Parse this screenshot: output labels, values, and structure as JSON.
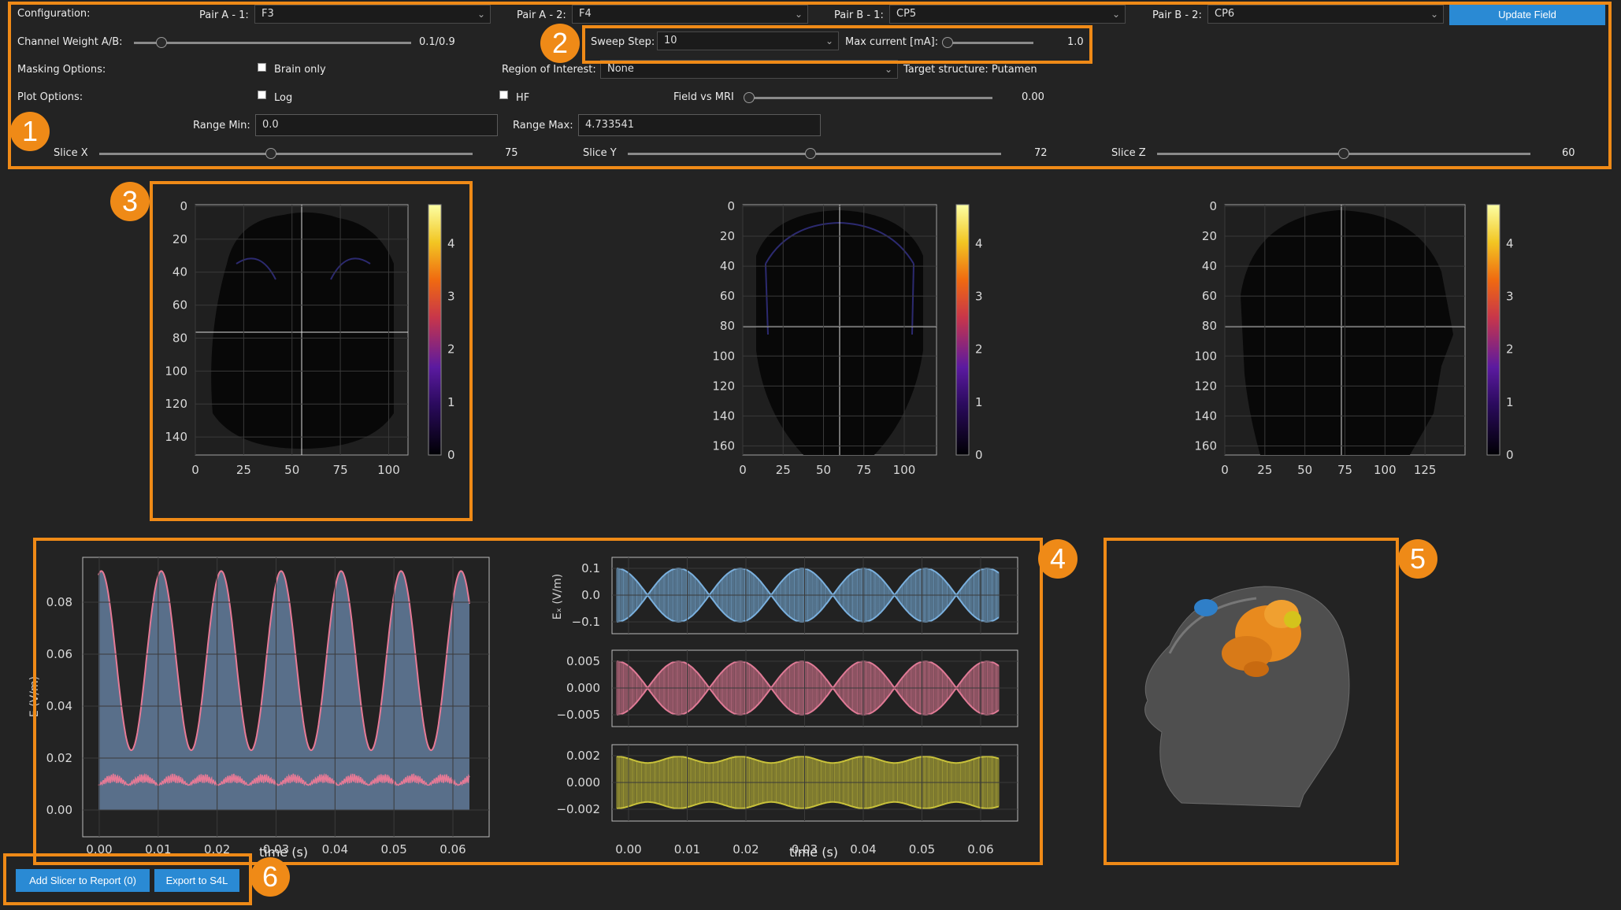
{
  "config": {
    "configuration_label": "Configuration:",
    "pair_a1_label": "Pair A - 1:",
    "pair_a1_value": "F3",
    "pair_a2_label": "Pair A - 2:",
    "pair_a2_value": "F4",
    "pair_b1_label": "Pair B - 1:",
    "pair_b1_value": "CP5",
    "pair_b2_label": "Pair B - 2:",
    "pair_b2_value": "CP6",
    "update_button": "Update Field",
    "channel_weight_label": "Channel Weight A/B:",
    "channel_weight_value": "0.1/0.9",
    "channel_weight_fraction": 0.1,
    "sweep_step_label": "Sweep Step:",
    "sweep_step_value": "10",
    "max_current_label": "Max current [mA]:",
    "max_current_value": "1.0",
    "masking_label": "Masking Options:",
    "brain_only_label": "Brain only",
    "roi_label": "Region of Interest:",
    "roi_value": "None",
    "target_structure": "Target structure: Putamen",
    "plot_options_label": "Plot Options:",
    "log_label": "Log",
    "hf_label": "HF",
    "field_vs_mri_label": "Field vs MRI",
    "field_vs_mri_value": "0.00",
    "range_min_label": "Range Min:",
    "range_min_value": "0.0",
    "range_max_label": "Range Max:",
    "range_max_value": "4.733541",
    "slice_x_label": "Slice X",
    "slice_x_value": "75",
    "slice_x_fraction": 0.46,
    "slice_y_label": "Slice Y",
    "slice_y_value": "72",
    "slice_y_fraction": 0.49,
    "slice_z_label": "Slice Z",
    "slice_z_value": "60",
    "slice_z_fraction": 0.5
  },
  "callouts": [
    "1",
    "2",
    "3",
    "4",
    "5",
    "6"
  ],
  "slices": [
    {
      "xticks": [
        "0",
        "25",
        "50",
        "75",
        "100"
      ],
      "yticks": [
        "0",
        "20",
        "40",
        "60",
        "80",
        "100",
        "120",
        "140"
      ]
    },
    {
      "xticks": [
        "0",
        "25",
        "50",
        "75",
        "100"
      ],
      "yticks": [
        "0",
        "20",
        "40",
        "60",
        "80",
        "100",
        "120",
        "140",
        "160"
      ]
    },
    {
      "xticks": [
        "0",
        "25",
        "50",
        "75",
        "100",
        "125"
      ],
      "yticks": [
        "0",
        "20",
        "40",
        "60",
        "80",
        "100",
        "120",
        "140",
        "160"
      ]
    }
  ],
  "colorbar_ticks": [
    "4",
    "3",
    "2",
    "1",
    "0"
  ],
  "main_plot": {
    "ylabel": "E (V/m)",
    "yticks": [
      "0.08",
      "0.06",
      "0.04",
      "0.02",
      "0.00"
    ],
    "xticks": [
      "0.00",
      "0.01",
      "0.02",
      "0.03",
      "0.04",
      "0.05",
      "0.06"
    ],
    "xlabel": "time (s)"
  },
  "component_plots": {
    "ex_ylabel": "Eₓ (V/m)",
    "ex_yticks": [
      "0.1",
      "0.0",
      "−0.1"
    ],
    "ey_yticks": [
      "0.005",
      "0.000",
      "−0.005"
    ],
    "ez_yticks": [
      "0.002",
      "0.000",
      "−0.002"
    ],
    "xticks": [
      "0.00",
      "0.01",
      "0.02",
      "0.03",
      "0.04",
      "0.05",
      "0.06"
    ],
    "xlabel": "time (s)",
    "colors": {
      "ex": "#7ab0de",
      "ey": "#e07a96",
      "ez": "#c9c23a"
    }
  },
  "footer": {
    "add_slicer_button": "Add Slicer to Report (0)",
    "export_button": "Export to S4L"
  },
  "colors": {
    "accent": "#ef8a17",
    "button": "#2a8ad4",
    "background": "#232323"
  }
}
